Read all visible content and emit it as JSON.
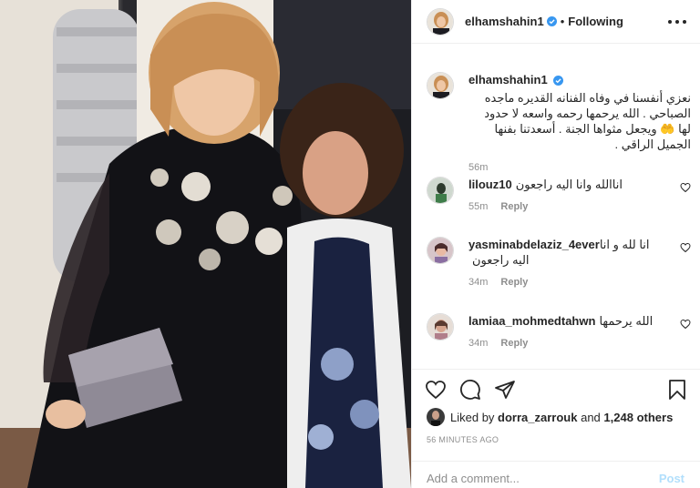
{
  "post": {
    "author": "elhamshahin1",
    "follow_status": "Following",
    "separator": "•"
  },
  "caption": {
    "username": "elhamshahin1",
    "text": "نعزي أنفسنا في وفاه الفنانه القديره ماجده الصباحي . الله يرحمها رحمه واسعه لا حدود لها 🤲 ويجعل مثواها الجنة . أسعدتنا بفنها الجميل الراقي .",
    "time": "56m"
  },
  "comments": [
    {
      "username": "lilouz10",
      "text": "اناالله وانا اليه راجعون",
      "time": "55m",
      "reply": "Reply"
    },
    {
      "username": "yasminabdelaziz_4ever",
      "text": "انا لله و انا اليه راجعون",
      "time": "34m",
      "reply": "Reply"
    },
    {
      "username": "lamiaa_mohmedtahwn",
      "text": "الله يرحمها",
      "time": "34m",
      "reply": "Reply"
    }
  ],
  "likes": {
    "prefix": "Liked by",
    "user": "dorra_zarrouk",
    "joiner": "and",
    "others": "1,248 others"
  },
  "time_ago": "56 MINUTES AGO",
  "add_comment": {
    "placeholder": "Add a comment...",
    "post_label": "Post"
  },
  "icons": {
    "like": "heart-icon",
    "comment": "comment-icon",
    "share": "share-icon",
    "save": "bookmark-icon",
    "more": "more-options-icon",
    "verified": "verified-badge-icon"
  },
  "colors": {
    "verified": "#3897f0",
    "muted": "#8e8e8e",
    "post_disabled": "#b2dffc"
  }
}
